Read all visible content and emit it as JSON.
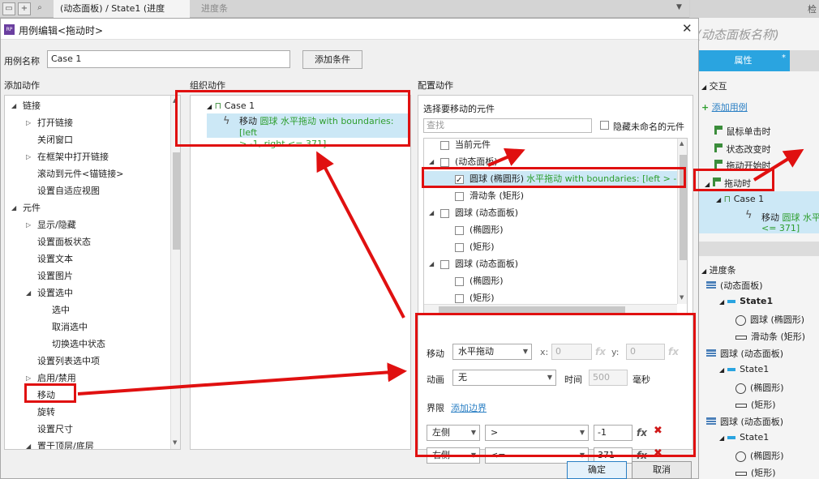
{
  "tabs": [
    {
      "label": "(动态面板) / State1 (进度条)",
      "active": true
    },
    {
      "label": "进度条",
      "active": false
    }
  ],
  "dialog": {
    "title": "用例编辑<拖动时>",
    "case_name_label": "用例名称",
    "case_name_value": "Case 1",
    "add_condition_label": "添加条件",
    "section_add": "添加动作",
    "section_org": "组织动作",
    "section_config": "配置动作",
    "ok_label": "确定",
    "cancel_label": "取消"
  },
  "add_actions": [
    {
      "label": "链接",
      "level": 0,
      "expanded": true
    },
    {
      "label": "打开链接",
      "level": 1,
      "collapsed": true
    },
    {
      "label": "关闭窗口",
      "level": 1
    },
    {
      "label": "在框架中打开链接",
      "level": 1,
      "collapsed": true
    },
    {
      "label": "滚动到元件<锚链接>",
      "level": 1
    },
    {
      "label": "设置自适应视图",
      "level": 1
    },
    {
      "label": "元件",
      "level": 0,
      "expanded": true
    },
    {
      "label": "显示/隐藏",
      "level": 1,
      "collapsed": true
    },
    {
      "label": "设置面板状态",
      "level": 1
    },
    {
      "label": "设置文本",
      "level": 1
    },
    {
      "label": "设置图片",
      "level": 1
    },
    {
      "label": "设置选中",
      "level": 1,
      "expanded": true
    },
    {
      "label": "选中",
      "level": 2
    },
    {
      "label": "取消选中",
      "level": 2
    },
    {
      "label": "切换选中状态",
      "level": 2
    },
    {
      "label": "设置列表选中项",
      "level": 1
    },
    {
      "label": "启用/禁用",
      "level": 1,
      "collapsed": true
    },
    {
      "label": "移动",
      "level": 1
    },
    {
      "label": "旋转",
      "level": 1
    },
    {
      "label": "设置尺寸",
      "level": 1
    },
    {
      "label": "置于顶层/底层",
      "level": 1,
      "expanded": true
    }
  ],
  "org": {
    "case": "Case 1",
    "action_prefix": "移动",
    "action_detail": "圆球 水平拖动 with boundaries: [left",
    "action_detail2": "> -1, right <= 371]"
  },
  "config": {
    "select_label": "选择要移动的元件",
    "search_placeholder": "查找",
    "hide_unnamed": "隐藏未命名的元件",
    "items": [
      {
        "label": "当前元件",
        "indent": 1,
        "checked": false
      },
      {
        "label": "(动态面板)",
        "indent": 1,
        "checked": false,
        "expanded": true
      },
      {
        "label": "圆球 (椭圆形)",
        "suffix": "水平拖动 with boundaries: [left > -1, r",
        "indent": 2,
        "checked": true
      },
      {
        "label": "滑动条 (矩形)",
        "indent": 2,
        "checked": false
      },
      {
        "label": "圆球 (动态面板)",
        "indent": 1,
        "checked": false,
        "expanded": true
      },
      {
        "label": "(椭圆形)",
        "indent": 2,
        "checked": false
      },
      {
        "label": "(矩形)",
        "indent": 2,
        "checked": false
      },
      {
        "label": "圆球 (动态面板)",
        "indent": 1,
        "checked": false,
        "expanded": true
      },
      {
        "label": "(椭圆形)",
        "indent": 2,
        "checked": false
      },
      {
        "label": "(矩形)",
        "indent": 2,
        "checked": false
      }
    ],
    "move_label": "移动",
    "move_value": "水平拖动",
    "x_label": "x:",
    "x_value": "0",
    "y_label": "y:",
    "y_value": "0",
    "fx": "fx",
    "anim_label": "动画",
    "anim_value": "无",
    "time_label": "时间",
    "time_value": "500",
    "ms_label": "毫秒",
    "bound_label": "界限",
    "add_bound": "添加边界",
    "bounds": [
      {
        "side": "左侧",
        "op": ">",
        "value": "-1"
      },
      {
        "side": "右侧",
        "op": "<=",
        "value": "371"
      }
    ]
  },
  "right_panel": {
    "top_label": "检",
    "name_placeholder": "(动态面板名称)",
    "tab": "属性",
    "tab_star": "*",
    "interaction": "交互",
    "add_case": "添加用例",
    "events": [
      "鼠标单击时",
      "状态改变时",
      "拖动开始时",
      "拖动时"
    ],
    "case": "Case 1",
    "action_prefix": "移动",
    "action_green": "圆球 水平",
    "action_tail": "<= 371]",
    "outline_title": "进度条",
    "outline": [
      {
        "label": "(动态面板)",
        "type": "panel",
        "indent": 0
      },
      {
        "label": "State1",
        "type": "state",
        "indent": 1,
        "bold": true
      },
      {
        "label": "圆球 (椭圆形)",
        "type": "circle",
        "indent": 2
      },
      {
        "label": "滑动条 (矩形)",
        "type": "rect",
        "indent": 2
      },
      {
        "label": "圆球 (动态面板)",
        "type": "panel",
        "indent": 0
      },
      {
        "label": "State1",
        "type": "state",
        "indent": 1
      },
      {
        "label": "(椭圆形)",
        "type": "circle",
        "indent": 2
      },
      {
        "label": "(矩形)",
        "type": "rect",
        "indent": 2
      },
      {
        "label": "圆球 (动态面板)",
        "type": "panel",
        "indent": 0
      },
      {
        "label": "State1",
        "type": "state",
        "indent": 1
      },
      {
        "label": "(椭圆形)",
        "type": "circle",
        "indent": 2
      },
      {
        "label": "(矩形)",
        "type": "rect",
        "indent": 2
      }
    ]
  },
  "colors": {
    "annotation": "#e01010",
    "selection": "#cce8f6",
    "accent": "#2aa4e0",
    "green": "#2e9e2e"
  }
}
